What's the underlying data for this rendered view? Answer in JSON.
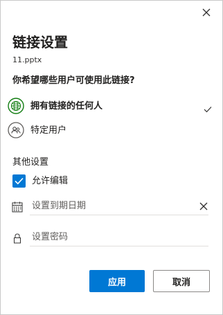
{
  "dialog": {
    "title": "链接设置",
    "filename": "11.pptx",
    "question": "你希望哪些用户可使用此链接?"
  },
  "options": [
    {
      "label": "拥有链接的任何人",
      "icon": "globe-icon",
      "selected": true
    },
    {
      "label": "特定用户",
      "icon": "people-icon",
      "selected": false
    }
  ],
  "other_settings": {
    "label": "其他设置",
    "allow_edit": {
      "label": "允许编辑",
      "checked": true
    },
    "expiry": {
      "placeholder": "设置到期日期",
      "value": ""
    },
    "password": {
      "placeholder": "设置密码",
      "value": ""
    }
  },
  "buttons": {
    "apply": "应用",
    "cancel": "取消"
  },
  "colors": {
    "accent": "#0078d4",
    "globe_icon": "#107c10",
    "text": "#201f1e"
  }
}
